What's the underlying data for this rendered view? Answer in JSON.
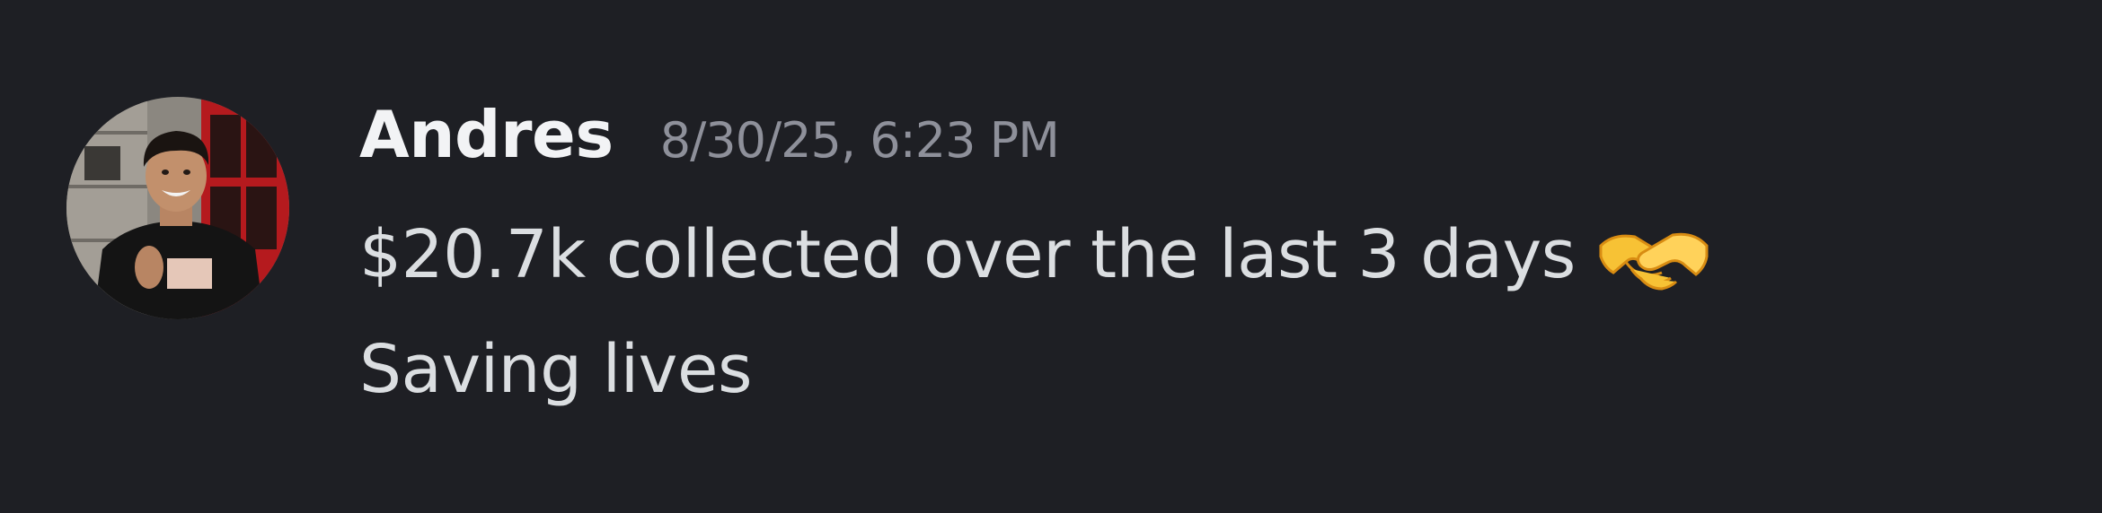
{
  "message": {
    "author": "Andres",
    "timestamp": "8/30/25, 6:23 PM",
    "lines": [
      "$20.7k collected over the last 3 days",
      "Saving lives"
    ],
    "reaction_emoji_icon": "handshake-emoji-icon"
  },
  "colors": {
    "background": "#1e1f24",
    "username": "#f2f3f5",
    "timestamp": "#8e909a",
    "message_text": "#dbdee1"
  }
}
